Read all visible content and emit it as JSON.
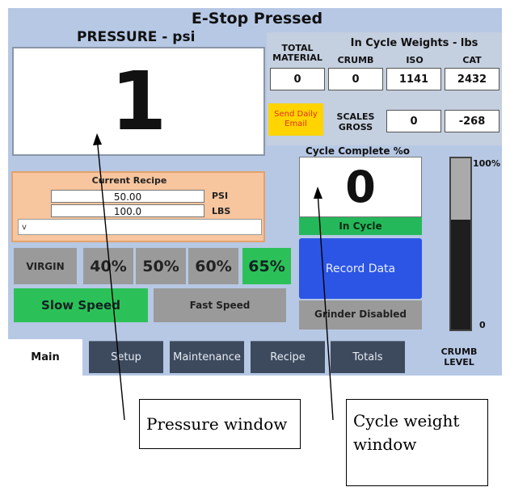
{
  "title": "E-Stop Pressed",
  "pressure": {
    "title": "PRESSURE - psi",
    "value": "1"
  },
  "weights": {
    "total_material_label": "TOTAL MATERIAL",
    "in_cycle_label": "In Cycle Weights - lbs",
    "col_crumb": "CRUMB",
    "col_iso": "ISO",
    "col_cat": "CAT",
    "total_material": "0",
    "crumb": "0",
    "iso": "1141",
    "cat": "2432",
    "send_email": "Send Daily Email",
    "scales_gross_label": "SCALES GROSS",
    "scales_iso": "0",
    "scales_cat": "-268"
  },
  "recipe": {
    "title": "Current Recipe",
    "psi_value": "50.00",
    "psi_unit": "PSI",
    "lbs_value": "100.0",
    "lbs_unit": "LBS",
    "selector": "v"
  },
  "mix": {
    "virgin": "VIRGIN",
    "options": [
      "40%",
      "50%",
      "60%",
      "65%"
    ],
    "selected": "65%"
  },
  "speed": {
    "slow": "Slow Speed",
    "fast": "Fast Speed",
    "selected": "Slow Speed"
  },
  "cycle": {
    "title": "Cycle Complete %o",
    "value": "0",
    "status": "In Cycle",
    "record_button": "Record Data",
    "grinder": "Grinder Disabled"
  },
  "crumb_level": {
    "label": "CRUMB LEVEL",
    "top": "100%",
    "bottom": "0",
    "fraction": 0.64
  },
  "tabs": [
    "Main",
    "Setup",
    "Maintenance",
    "Recipe",
    "Totals"
  ],
  "active_tab": "Main",
  "callouts": {
    "pressure": "Pressure window",
    "cycle": "Cycle weight window"
  },
  "colors": {
    "panel_bg": "#b6c8e4",
    "selected_green": "#2cc158",
    "record_blue": "#2c55e6",
    "email_yellow": "#ffd400",
    "recipe_orange": "#f7c59e",
    "tab_dark": "#3d4a5e"
  }
}
